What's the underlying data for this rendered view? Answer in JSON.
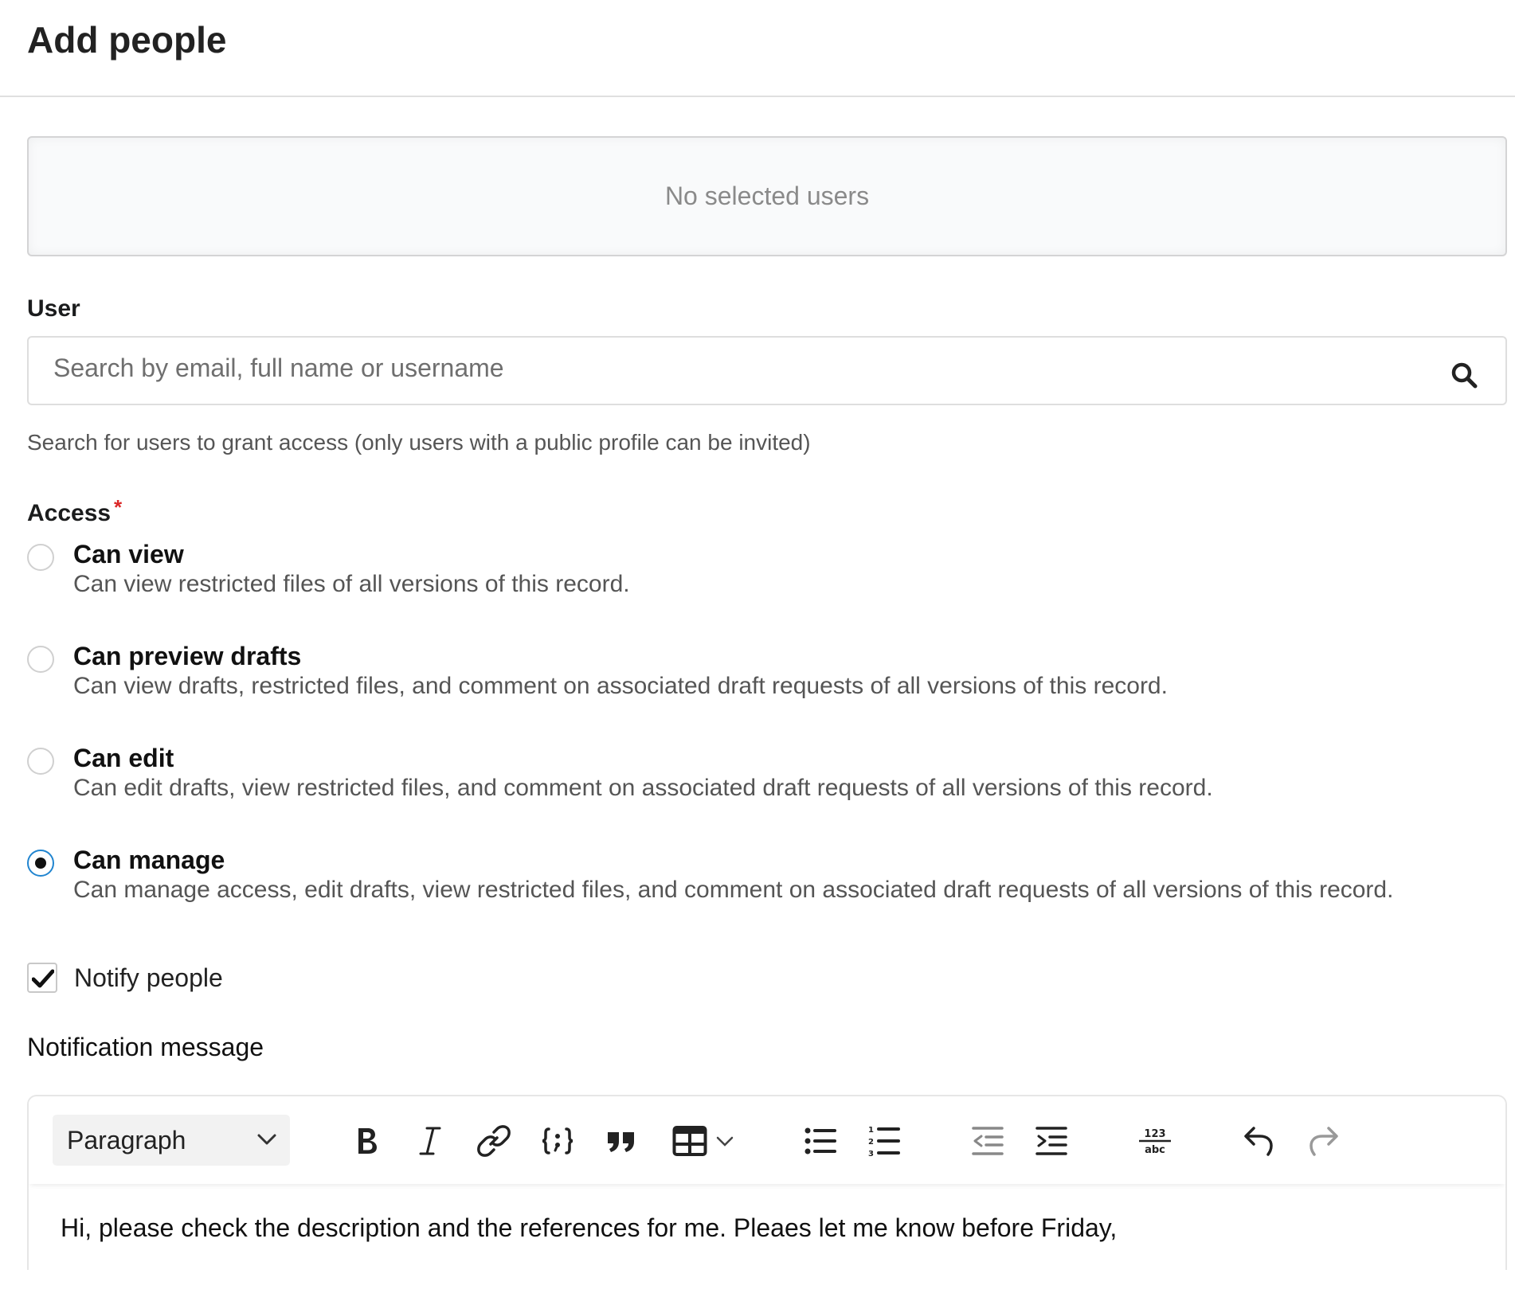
{
  "header": {
    "title": "Add people"
  },
  "selected_users": {
    "empty_text": "No selected users"
  },
  "user_field": {
    "label": "User",
    "placeholder": "Search by email, full name or username",
    "value": "",
    "help": "Search for users to grant access (only users with a public profile can be invited)"
  },
  "access": {
    "label": "Access",
    "required_marker": "*",
    "selected": "Can manage",
    "options": [
      {
        "title": "Can view",
        "description": "Can view restricted files of all versions of this record."
      },
      {
        "title": "Can preview drafts",
        "description": "Can view drafts, restricted files, and comment on associated draft requests of all versions of this record."
      },
      {
        "title": "Can edit",
        "description": "Can edit drafts, view restricted files, and comment on associated draft requests of all versions of this record."
      },
      {
        "title": "Can manage",
        "description": "Can manage access, edit drafts, view restricted files, and comment on associated draft requests of all versions of this record."
      }
    ]
  },
  "notify": {
    "label": "Notify people",
    "checked": true
  },
  "notification": {
    "label": "Notification message",
    "toolbar": {
      "block_format": "Paragraph",
      "buttons": [
        "bold-icon",
        "italic-icon",
        "link-icon",
        "code-block-icon",
        "blockquote-icon",
        "table-icon",
        "bullet-list-icon",
        "numbered-list-icon",
        "outdent-icon",
        "indent-icon",
        "character-count-icon",
        "undo-icon",
        "redo-icon"
      ],
      "character_count_glyph": {
        "top": "123",
        "bottom": "abc"
      }
    },
    "body": "Hi, please check the description and the references for me. Pleaes let me know before Friday,"
  },
  "colors": {
    "accent": "#2185d0",
    "required": "#db2828",
    "muted_text": "#555555"
  }
}
